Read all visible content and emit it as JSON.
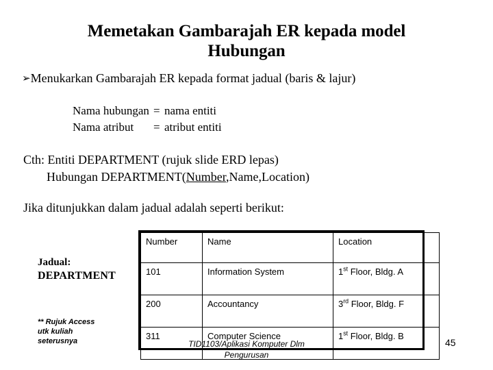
{
  "slide": {
    "title_line1": "Memetakan Gambarajah ER kepada model",
    "title_line2": "Hubungan",
    "bullet_glyph": "➢",
    "bullet_text": "Menukarkan Gambarajah ER kepada format jadual (baris & lajur)",
    "mapping": [
      {
        "key": "Nama hubungan",
        "eq": "=",
        "value": "nama entiti"
      },
      {
        "key": "Nama atribut",
        "eq": "=",
        "value": "atribut entiti"
      }
    ],
    "example_line1": "Cth: Entiti DEPARTMENT (rujuk slide ERD lepas)",
    "example_line2_prefix": "Hubungan DEPARTMENT(",
    "example_line2_pk": "Number",
    "example_line2_suffix": ",Name,Location)",
    "intro_table_line": "Jika ditunjukkan dalam jadual adalah seperti berikut:",
    "jadual_label_top": "Jadual:",
    "jadual_label_bottom": "DEPARTMENT",
    "note_lines": [
      "** Rujuk Access",
      "utk kuliah",
      "seterusnya"
    ],
    "footer_line1": "TID1103/Aplikasi Komputer Dlm",
    "footer_line2": "Pengurusan",
    "page_number": "45"
  },
  "table": {
    "headers": [
      "Number",
      "Name",
      "Location"
    ],
    "rows": [
      {
        "number": "101",
        "name": "Information System",
        "loc_ordinal": "1",
        "loc_suffix": "st",
        "loc_rest": " Floor, Bldg. A"
      },
      {
        "number": "200",
        "name": "Accountancy",
        "loc_ordinal": "3",
        "loc_suffix": "rd",
        "loc_rest": " Floor, Bldg. F"
      },
      {
        "number": "311",
        "name": "Computer Science",
        "loc_ordinal": "1",
        "loc_suffix": "st",
        "loc_rest": " Floor, Bldg. B"
      }
    ]
  },
  "colors": {
    "background": "#ffffff",
    "text": "#000000",
    "table_border": "#000000"
  }
}
